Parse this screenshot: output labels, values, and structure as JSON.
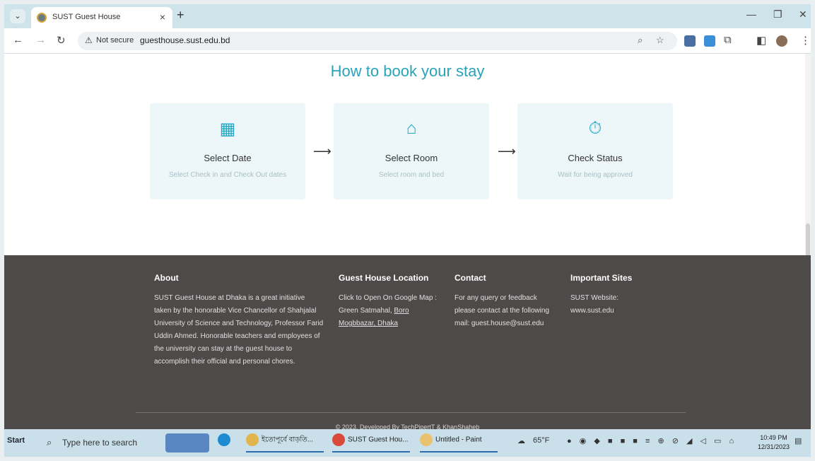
{
  "browser": {
    "tab_title": "SUST Guest House",
    "url": "guesthouse.sust.edu.bd",
    "security_label": "Not secure"
  },
  "page": {
    "heading": "How to book your stay",
    "steps": [
      {
        "icon": "calendar-icon",
        "title": "Select Date",
        "desc": "Select Check in and Check Out dates"
      },
      {
        "icon": "home-icon",
        "title": "Select Room",
        "desc": "Select room and bed"
      },
      {
        "icon": "stopwatch-icon",
        "title": "Check Status",
        "desc": "Wait for being approved"
      }
    ],
    "arrow": "⟶"
  },
  "footer": {
    "about": {
      "title": "About",
      "text": "SUST Guest House at Dhaka is a great initiative taken by the honorable Vice Chancellor of Shahjalal University of Science and Technology, Professor Farid Uddin Ahmed. Honorable teachers and employees of the university can stay at the guest house to accomplish their official and personal chores."
    },
    "location": {
      "title": "Guest House Location",
      "text": "Click to Open On Google Map : Green Satmahal,",
      "link": "Boro Mogbbazar, Dhaka"
    },
    "contact": {
      "title": "Contact",
      "text": "For any query or feedback please contact at the following mail:",
      "email": "guest.house@sust.edu"
    },
    "sites": {
      "title": "Important Sites",
      "label": "SUST Website:",
      "link": "www.sust.edu"
    },
    "copyright": "© 2023, Developed By TechPipertT & KhanShaheb"
  },
  "taskbar": {
    "start": "Start",
    "search_placeholder": "Type here to search",
    "items": [
      "ইতোপূর্বে বাড়তি...",
      "SUST Guest Hou...",
      "Untitled - Paint"
    ],
    "weather": "65°F",
    "time": "10:49 PM",
    "date": "12/31/2023"
  }
}
